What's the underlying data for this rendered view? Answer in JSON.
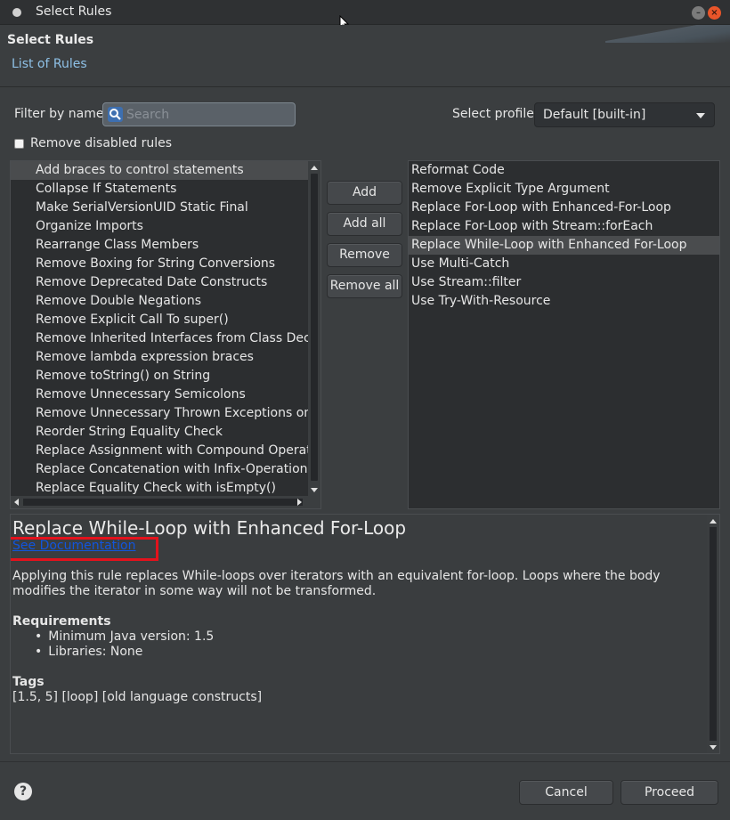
{
  "window": {
    "title": "Select Rules"
  },
  "header": {
    "title": "Select Rules",
    "subtitle": "List of Rules"
  },
  "filter": {
    "label": "Filter by name",
    "placeholder": "Search",
    "value": ""
  },
  "profile": {
    "label": "Select profile",
    "selected": "Default [built-in]"
  },
  "remove_disabled": {
    "label": "Remove disabled rules",
    "checked": false
  },
  "available_rules": [
    "Add braces to control statements",
    "Collapse If Statements",
    "Make SerialVersionUID Static Final",
    "Organize Imports",
    "Rearrange Class Members",
    "Remove Boxing for String Conversions",
    "Remove Deprecated Date Constructs",
    "Remove Double Negations",
    "Remove Explicit Call To super()",
    "Remove Inherited Interfaces from Class Declar",
    "Remove lambda expression braces",
    "Remove toString() on String",
    "Remove Unnecessary Semicolons",
    "Remove Unnecessary Thrown Exceptions on M",
    "Reorder String Equality Check",
    "Replace Assignment with Compound Operator",
    "Replace Concatenation with Infix-Operation",
    "Replace Equality Check with isEmpty()"
  ],
  "available_selected_index": 0,
  "buttons": {
    "add": "Add",
    "add_all": "Add all",
    "remove": "Remove",
    "remove_all": "Remove all",
    "cancel": "Cancel",
    "proceed": "Proceed"
  },
  "selected_rules": [
    "Reformat Code",
    "Remove Explicit Type Argument",
    "Replace For-Loop with Enhanced-For-Loop",
    "Replace For-Loop with Stream::forEach",
    "Replace While-Loop with Enhanced For-Loop",
    "Use Multi-Catch",
    "Use Stream::filter",
    "Use Try-With-Resource"
  ],
  "selected_rules_selected_index": 4,
  "description": {
    "title": "Replace While-Loop with Enhanced For-Loop",
    "doc_link": "See Documentation",
    "text": "Applying this rule replaces While-loops over iterators with an equivalent for-loop. Loops where the body modifies the iterator in some way will not be transformed.",
    "requirements_heading": "Requirements",
    "requirements": [
      "Minimum Java version: 1.5",
      "Libraries: None"
    ],
    "tags_heading": "Tags",
    "tags": "[1.5, 5]  [loop]  [old language constructs]"
  },
  "colors": {
    "background": "#3b3e40",
    "list_background": "#2c2e30",
    "selection": "#4a4c4e",
    "link": "#1155dd",
    "highlight_box": "#e3121c",
    "close_button": "#e9552a"
  },
  "icons": {
    "help": "help-icon",
    "search": "search-icon",
    "close": "close-icon",
    "minimize": "minimize-icon"
  }
}
